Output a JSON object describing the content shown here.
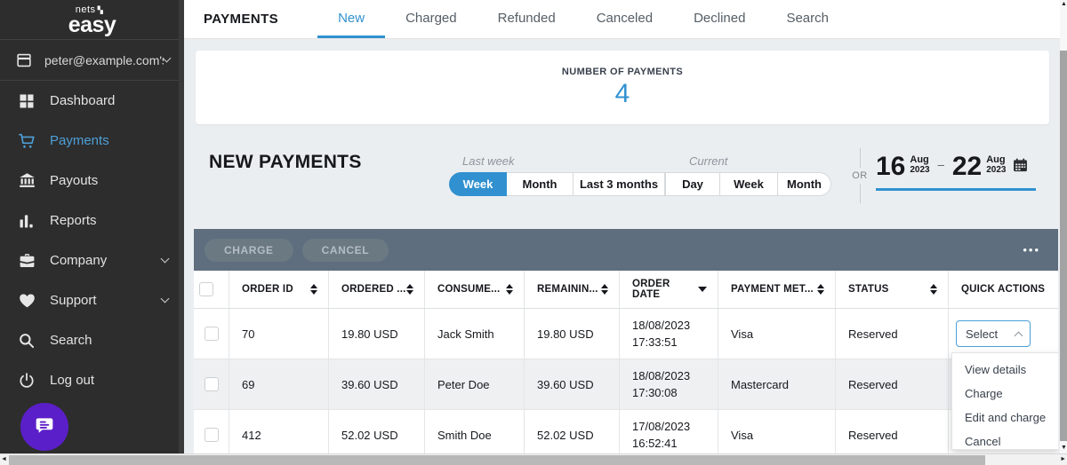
{
  "sidebar": {
    "logo": {
      "small": "nets",
      "mark": "▚",
      "big": "easy"
    },
    "account": {
      "label": "peter@example.com's...",
      "icon": "storefront-icon"
    },
    "items": [
      {
        "label": "Dashboard",
        "icon": "dashboard-icon"
      },
      {
        "label": "Payments",
        "icon": "cart-icon",
        "active": true
      },
      {
        "label": "Payouts",
        "icon": "bank-icon"
      },
      {
        "label": "Reports",
        "icon": "bar-chart-icon"
      },
      {
        "label": "Company",
        "icon": "briefcase-icon",
        "expandable": true
      },
      {
        "label": "Support",
        "icon": "heart-icon",
        "expandable": true
      },
      {
        "label": "Search",
        "icon": "search-icon"
      },
      {
        "label": "Log out",
        "icon": "power-icon"
      }
    ]
  },
  "topnav": {
    "title": "PAYMENTS",
    "tabs": [
      {
        "label": "New",
        "active": true
      },
      {
        "label": "Charged"
      },
      {
        "label": "Refunded"
      },
      {
        "label": "Canceled"
      },
      {
        "label": "Declined"
      },
      {
        "label": "Search"
      }
    ]
  },
  "summary_card": {
    "label": "NUMBER OF PAYMENTS",
    "value": "4"
  },
  "filters": {
    "heading": "NEW PAYMENTS",
    "last_week_label": "Last week",
    "current_label": "Current",
    "last_week_options": [
      {
        "label": "Week",
        "selected": true
      },
      {
        "label": "Month"
      },
      {
        "label": "Last 3 months"
      }
    ],
    "current_options": [
      {
        "label": "Day"
      },
      {
        "label": "Week"
      },
      {
        "label": "Month"
      }
    ],
    "or_label": "OR",
    "date_range": {
      "from_day": "16",
      "from_month": "Aug",
      "from_year": "2023",
      "separator": "–",
      "to_day": "22",
      "to_month": "Aug",
      "to_year": "2023"
    }
  },
  "table": {
    "toolbar": {
      "charge_label": "CHARGE",
      "cancel_label": "CANCEL",
      "more_label": "•••"
    },
    "columns": [
      {
        "label": "ORDER ID",
        "sort": "both"
      },
      {
        "label": "ORDERED ...",
        "sort": "both"
      },
      {
        "label": "CONSUME...",
        "sort": "both"
      },
      {
        "label": "REMAININ...",
        "sort": "both"
      },
      {
        "label": "ORDER DATE",
        "sort": "desc"
      },
      {
        "label": "PAYMENT MET...",
        "sort": "both"
      },
      {
        "label": "STATUS",
        "sort": "both"
      },
      {
        "label": "QUICK ACTIONS",
        "sort": "none"
      }
    ],
    "rows": [
      {
        "order_id": "70",
        "ordered": "19.80 USD",
        "consumer": "Jack Smith",
        "remaining": "19.80 USD",
        "date": "18/08/2023",
        "time": "17:33:51",
        "method": "Visa",
        "status": "Reserved",
        "quick_action": "Select"
      },
      {
        "order_id": "69",
        "ordered": "39.60 USD",
        "consumer": "Peter Doe",
        "remaining": "39.60 USD",
        "date": "18/08/2023",
        "time": "17:30:08",
        "method": "Mastercard",
        "status": "Reserved"
      },
      {
        "order_id": "412",
        "ordered": "52.02 USD",
        "consumer": "Smith Doe",
        "remaining": "52.02 USD",
        "date": "17/08/2023",
        "time": "16:52:41",
        "method": "Visa",
        "status": "Reserved"
      }
    ],
    "action_menu": [
      {
        "label": "View details"
      },
      {
        "label": "Charge"
      },
      {
        "label": "Edit and charge"
      },
      {
        "label": "Cancel"
      }
    ]
  },
  "colors": {
    "accent_blue": "#3191d0",
    "sidebar_active_blue": "#4da0d8",
    "toolbar_slate": "#5e6e7e",
    "chat_purple": "#5b1fc9",
    "sidebar_bg": "#2d2d2d",
    "content_bg": "#ebeef1"
  }
}
